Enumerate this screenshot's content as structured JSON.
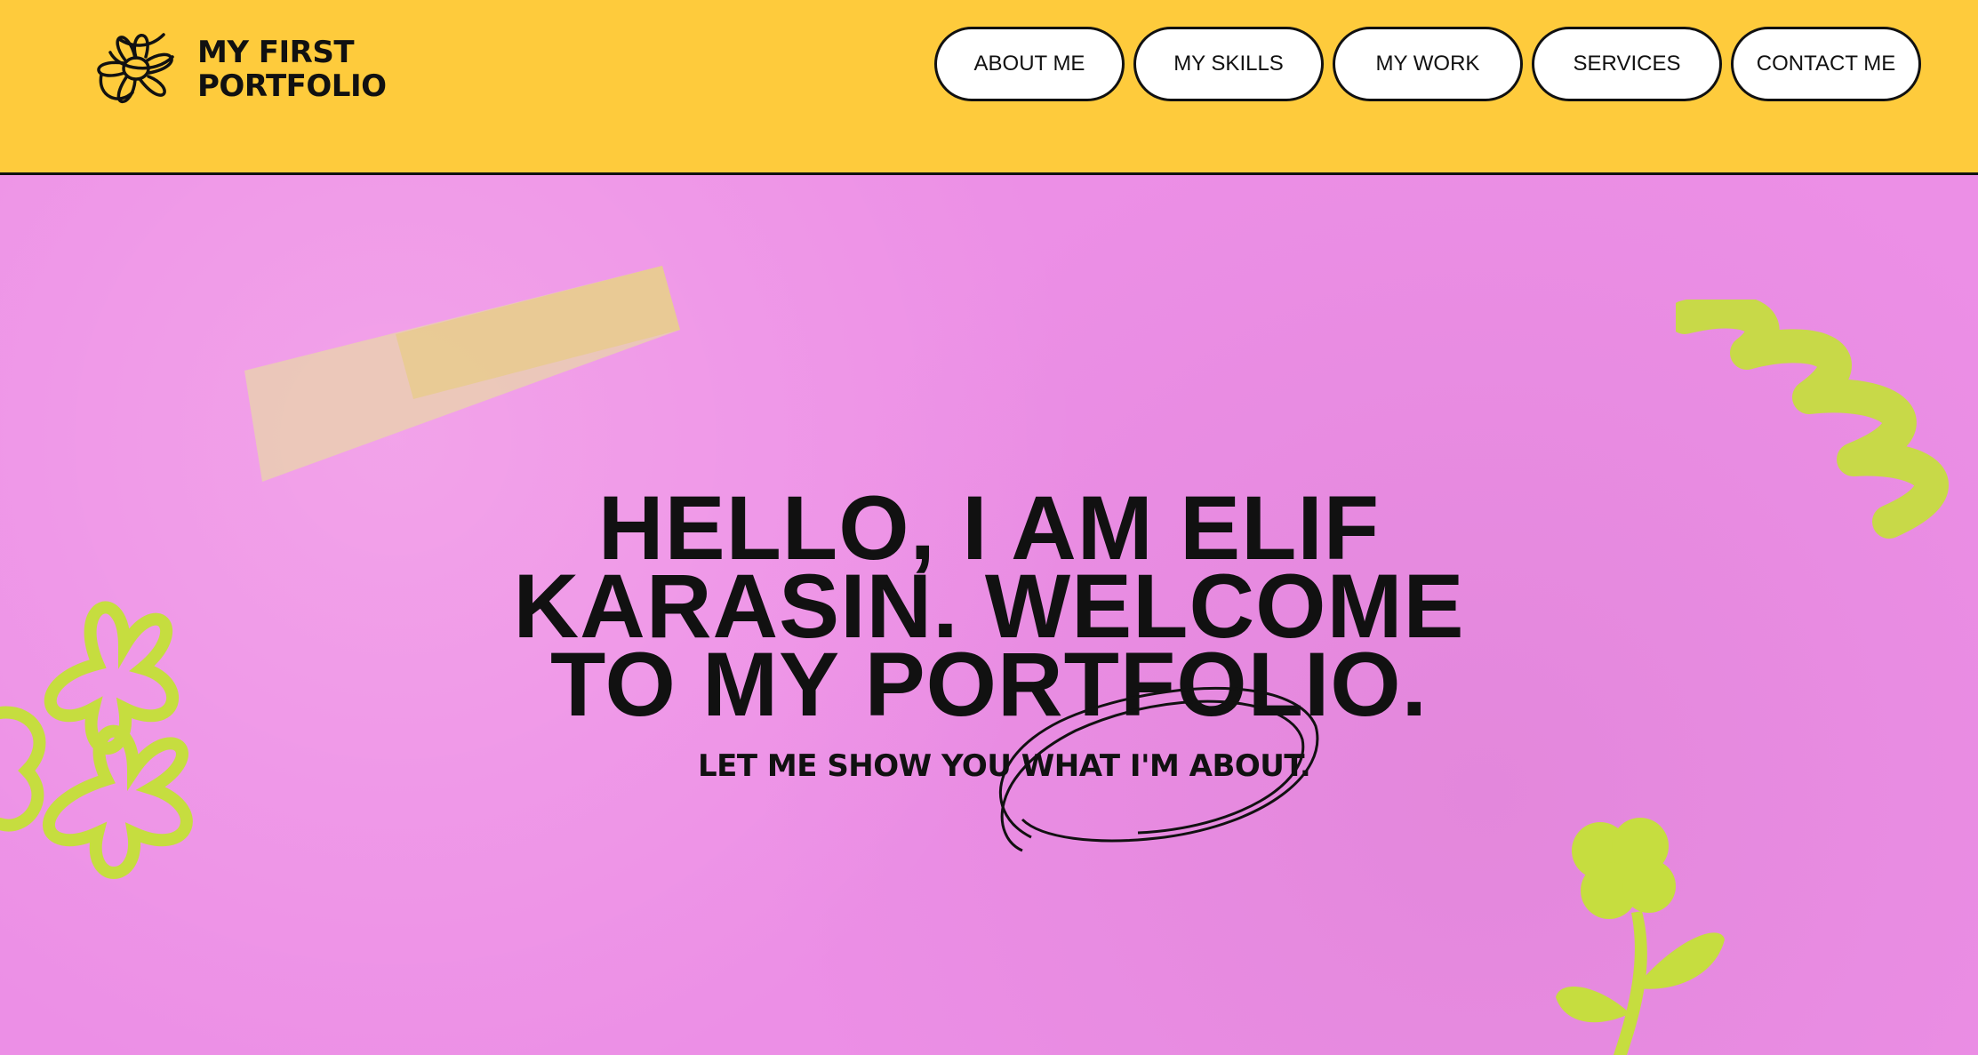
{
  "logo": {
    "line1": "MY FIRST",
    "line2": "PORTFOLIO",
    "icon": "scribble-flower-icon"
  },
  "nav": {
    "items": [
      {
        "label": "ABOUT ME"
      },
      {
        "label": "MY SKILLS"
      },
      {
        "label": "MY WORK"
      },
      {
        "label": "SERVICES"
      },
      {
        "label": "CONTACT ME"
      }
    ]
  },
  "hero": {
    "headline": {
      "line1": "HELLO, I AM ELIF",
      "line2": "KARASIN. WELCOME",
      "line3": "TO MY PORTFOLIO."
    },
    "tagline": "LET ME SHOW YOU WHAT I'M ABOUT."
  },
  "colors": {
    "header_bg": "#fecb3c",
    "hero_bg": "#ec8fe6",
    "accent_green": "#c6dd3f",
    "text": "#111111"
  }
}
